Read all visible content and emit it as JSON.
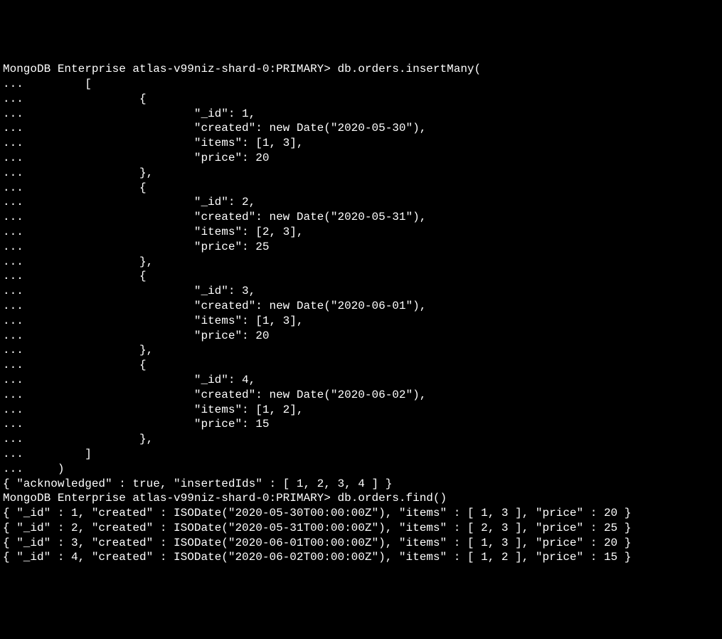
{
  "prompt": "MongoDB Enterprise atlas-v99niz-shard-0:PRIMARY>",
  "insertCommand": "db.orders.insertMany(",
  "findCommand": "db.orders.find()",
  "continuation": "...",
  "insertBody": {
    "lines": [
      "...         [",
      "...                 {",
      "...                         \"_id\": 1,",
      "...                         \"created\": new Date(\"2020-05-30\"),",
      "...                         \"items\": [1, 3],",
      "...                         \"price\": 20",
      "...                 },",
      "...                 {",
      "...                         \"_id\": 2,",
      "...                         \"created\": new Date(\"2020-05-31\"),",
      "...                         \"items\": [2, 3],",
      "...                         \"price\": 25",
      "...                 },",
      "...                 {",
      "...                         \"_id\": 3,",
      "...                         \"created\": new Date(\"2020-06-01\"),",
      "...                         \"items\": [1, 3],",
      "...                         \"price\": 20",
      "...                 },",
      "...                 {",
      "...                         \"_id\": 4,",
      "...                         \"created\": new Date(\"2020-06-02\"),",
      "...                         \"items\": [1, 2],",
      "...                         \"price\": 15",
      "...                 },",
      "...         ]",
      "...     )"
    ]
  },
  "insertResponse": "{ \"acknowledged\" : true, \"insertedIds\" : [ 1, 2, 3, 4 ] }",
  "findResults": [
    "{ \"_id\" : 1, \"created\" : ISODate(\"2020-05-30T00:00:00Z\"), \"items\" : [ 1, 3 ], \"price\" : 20 }",
    "{ \"_id\" : 2, \"created\" : ISODate(\"2020-05-31T00:00:00Z\"), \"items\" : [ 2, 3 ], \"price\" : 25 }",
    "{ \"_id\" : 3, \"created\" : ISODate(\"2020-06-01T00:00:00Z\"), \"items\" : [ 1, 3 ], \"price\" : 20 }",
    "{ \"_id\" : 4, \"created\" : ISODate(\"2020-06-02T00:00:00Z\"), \"items\" : [ 1, 2 ], \"price\" : 15 }"
  ]
}
